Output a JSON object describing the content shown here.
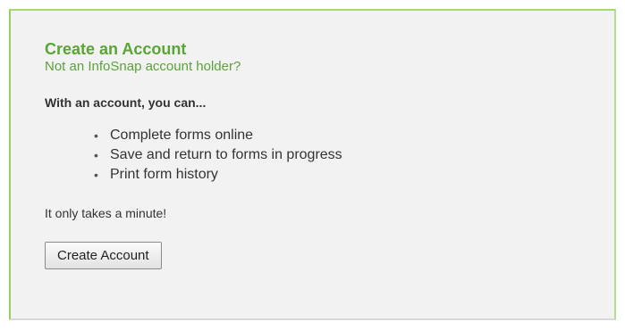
{
  "account": {
    "title": "Create an Account",
    "subtitle": "Not an InfoSnap account holder?",
    "with_account_heading": "With an account, you can...",
    "benefits": [
      "Complete forms online",
      "Save and return to forms in progress",
      "Print form history"
    ],
    "minute_text": "It only takes a minute!",
    "button_label": "Create Account"
  },
  "colors": {
    "accent_green": "#59a535",
    "panel_border_green": "#99cc66",
    "panel_background": "#f2f2f2"
  }
}
